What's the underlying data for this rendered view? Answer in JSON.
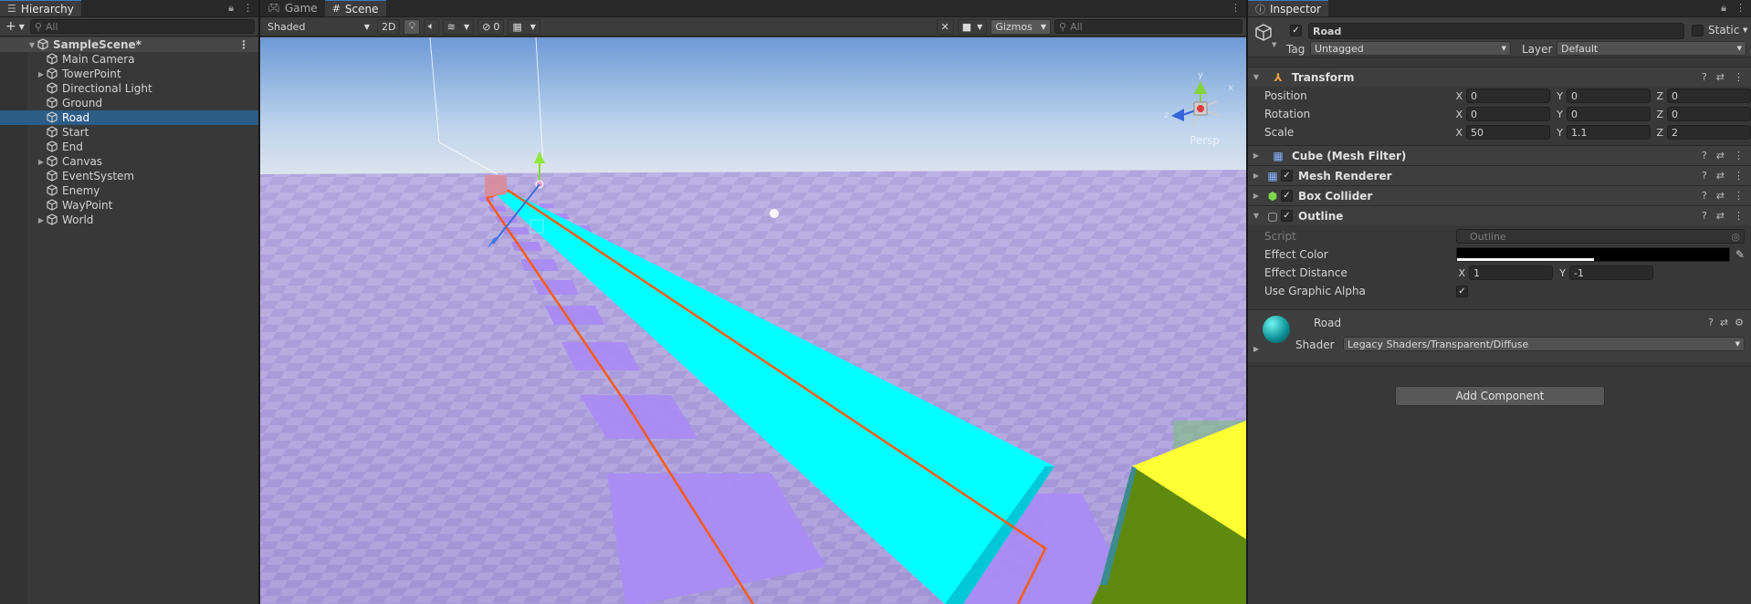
{
  "hierarchy": {
    "tab_label": "Hierarchy",
    "search_placeholder": "All",
    "add_label": "+",
    "scene_name": "SampleScene*",
    "items": [
      {
        "label": "Main Camera",
        "foldable": false,
        "selected": false
      },
      {
        "label": "TowerPoint",
        "foldable": true,
        "selected": false
      },
      {
        "label": "Directional Light",
        "foldable": false,
        "selected": false
      },
      {
        "label": "Ground",
        "foldable": false,
        "selected": false
      },
      {
        "label": "Road",
        "foldable": false,
        "selected": true
      },
      {
        "label": "Start",
        "foldable": false,
        "selected": false
      },
      {
        "label": "End",
        "foldable": false,
        "selected": false
      },
      {
        "label": "Canvas",
        "foldable": true,
        "selected": false
      },
      {
        "label": "EventSystem",
        "foldable": false,
        "selected": false
      },
      {
        "label": "Enemy",
        "foldable": false,
        "selected": false
      },
      {
        "label": "WayPoint",
        "foldable": false,
        "selected": false
      },
      {
        "label": "World",
        "foldable": true,
        "selected": false
      }
    ]
  },
  "scene": {
    "tabs": [
      {
        "label": "Game",
        "icon": "gamepad-icon",
        "active": false
      },
      {
        "label": "Scene",
        "icon": "grid-icon",
        "active": true
      }
    ],
    "draw_mode": "Shaded",
    "mode_2d": "2D",
    "hidden_count": "0",
    "gizmos_label": "Gizmos",
    "search_placeholder": "All",
    "persp_label": "Persp",
    "gizmo_axes": {
      "x": "x",
      "y": "y",
      "z": "z"
    }
  },
  "inspector": {
    "tab_label": "Inspector",
    "object_name": "Road",
    "static_label": "Static",
    "tag_label": "Tag",
    "tag_value": "Untagged",
    "layer_label": "Layer",
    "layer_value": "Default",
    "transform": {
      "title": "Transform",
      "position_label": "Position",
      "rotation_label": "Rotation",
      "scale_label": "Scale",
      "position": {
        "x": "0",
        "y": "0",
        "z": "0"
      },
      "rotation": {
        "x": "0",
        "y": "0",
        "z": "0"
      },
      "scale": {
        "x": "50",
        "y": "1.1",
        "z": "2"
      }
    },
    "mesh_filter_title": "Cube (Mesh Filter)",
    "mesh_renderer_title": "Mesh Renderer",
    "box_collider_title": "Box Collider",
    "outline": {
      "title": "Outline",
      "script_label": "Script",
      "script_value": "Outline",
      "effect_color_label": "Effect Color",
      "effect_distance_label": "Effect Distance",
      "effect_distance": {
        "x": "1",
        "y": "-1"
      },
      "use_graphic_alpha_label": "Use Graphic Alpha"
    },
    "material": {
      "name": "Road",
      "shader_label": "Shader",
      "shader_value": "Legacy Shaders/Transparent/Diffuse"
    },
    "add_component_label": "Add Component",
    "axis_labels": {
      "x": "X",
      "y": "Y",
      "z": "Z"
    }
  },
  "colors": {
    "selection": "#2c5d87",
    "road": "#00ffff",
    "outline": "#ff5a14",
    "plane": "#b4a6ff",
    "cube_yellow": "#ffff33",
    "cube_green": "#5e8a0e"
  }
}
